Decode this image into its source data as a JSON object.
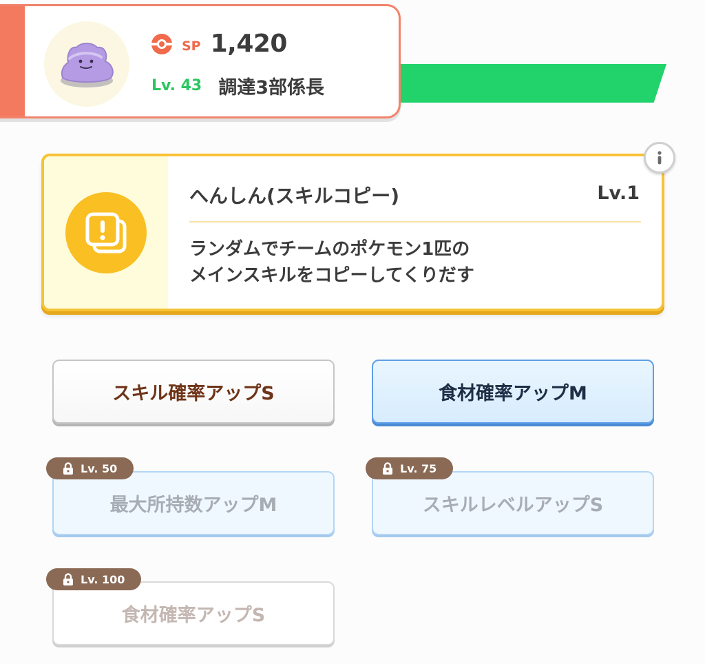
{
  "header": {
    "sp_label": "SP",
    "sp_value": "1,420",
    "level": "Lv. 43",
    "title": "調達3部係長",
    "stripe_color": "#f47a5f",
    "progress_color": "#22d26b"
  },
  "skill": {
    "name": "へんしん(スキルコピー)",
    "level": "Lv.1",
    "description_line1": "ランダムでチームのポケモン1匹の",
    "description_line2": "メインスキルをコピーしてくりだす",
    "icon": "skill-copy-icon",
    "accent_color": "#f9bf23"
  },
  "subskills": [
    {
      "label": "スキル確率アップS",
      "locked": false,
      "style": "white"
    },
    {
      "label": "食材確率アップM",
      "locked": false,
      "style": "blue"
    },
    {
      "label": "最大所持数アップM",
      "locked": true,
      "unlock_level": "Lv. 50",
      "style": "blue"
    },
    {
      "label": "スキルレベルアップS",
      "locked": true,
      "unlock_level": "Lv. 75",
      "style": "blue"
    },
    {
      "label": "食材確率アップS",
      "locked": true,
      "unlock_level": "Lv. 100",
      "style": "white"
    }
  ]
}
